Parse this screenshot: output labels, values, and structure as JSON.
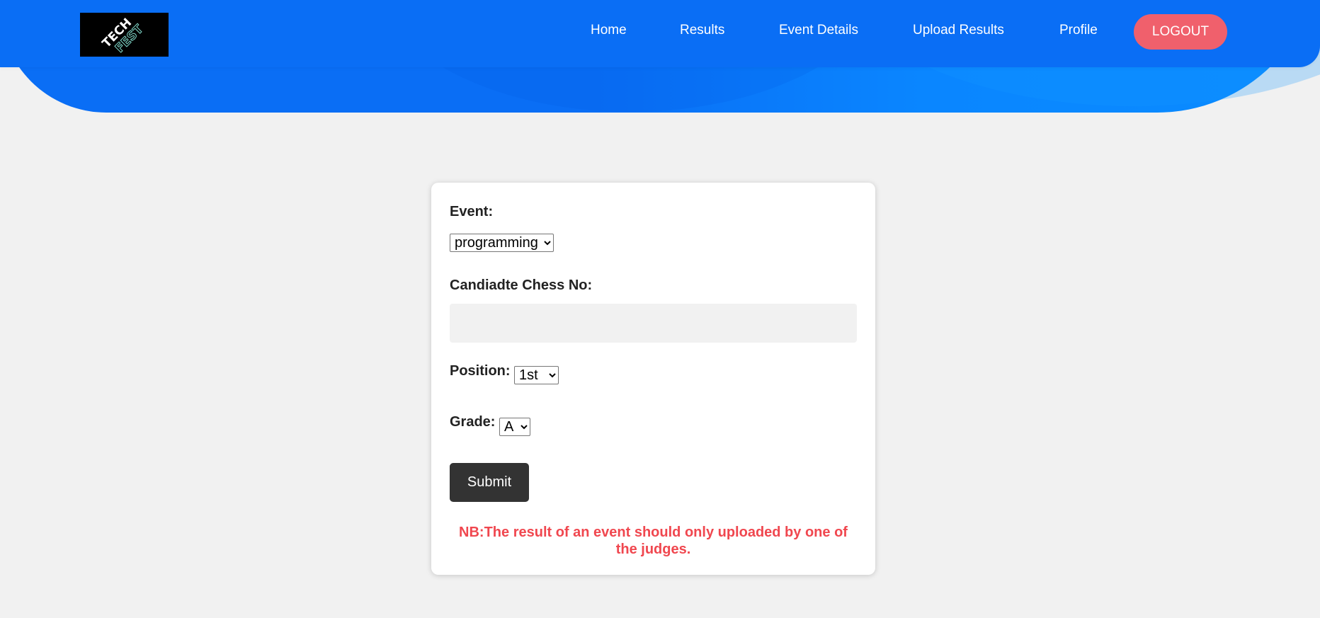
{
  "brand": {
    "logo_text_main": "TECH",
    "logo_text_sub": "FEST",
    "logo_icon": "techfest-logo"
  },
  "nav": {
    "home": "Home",
    "results": "Results",
    "event_details": "Event Details",
    "upload_results": "Upload Results",
    "profile": "Profile",
    "logout": "LOGOUT"
  },
  "form": {
    "event_label": "Event:",
    "event_selected": "programming",
    "chess_no_label": "Candiadte Chess No:",
    "chess_no_value": "",
    "position_label": "Position:",
    "position_selected": "1st",
    "grade_label": "Grade:",
    "grade_selected": "A",
    "submit_label": "Submit",
    "note": "NB:The result of an event should only uploaded by one of the judges."
  },
  "colors": {
    "primary": "#0a6ef5",
    "logout": "#f0606c",
    "submit": "#333333",
    "note": "#f0474f",
    "background": "#f1f1f1"
  }
}
